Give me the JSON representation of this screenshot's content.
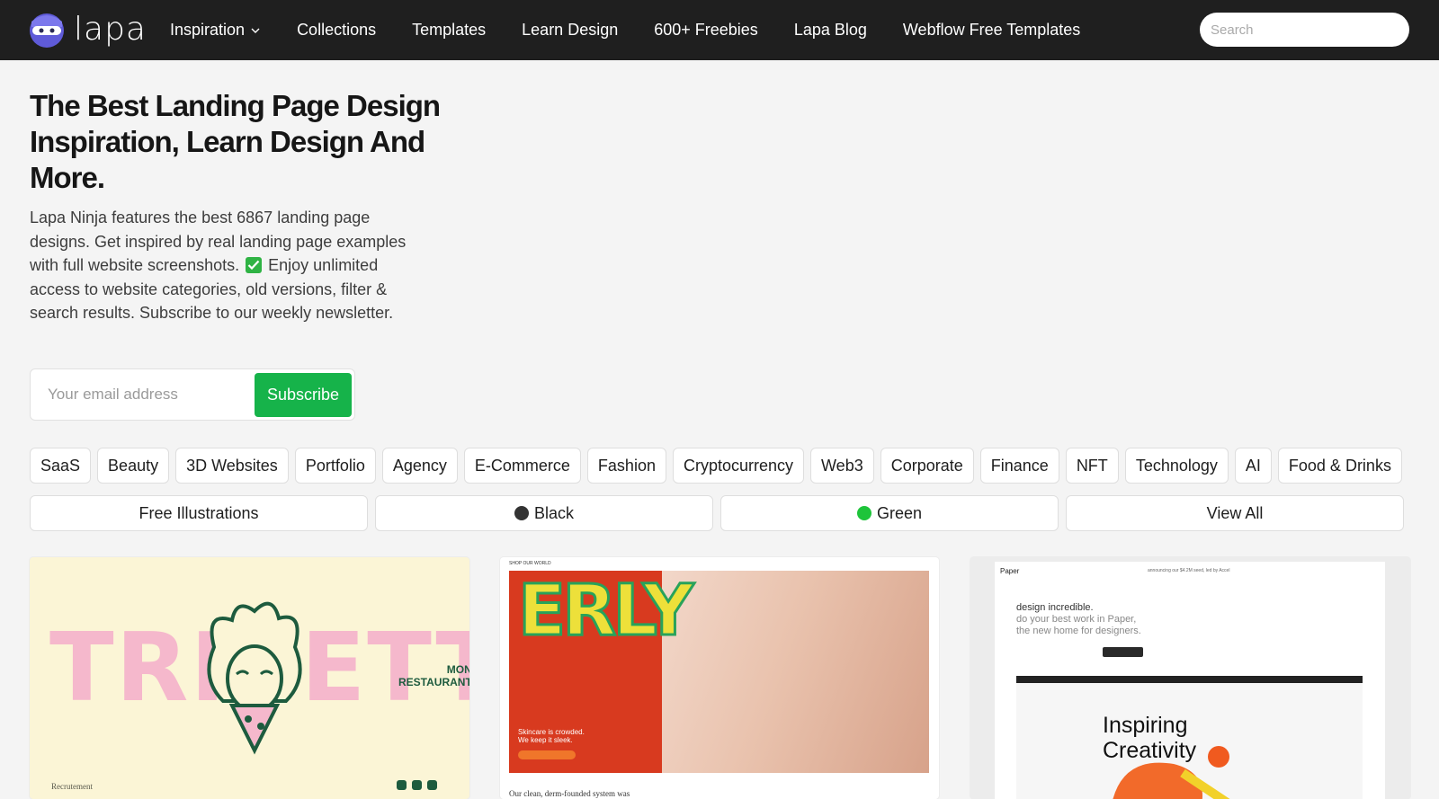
{
  "nav": {
    "logo_text": "lapa",
    "links": [
      "Inspiration",
      "Collections",
      "Templates",
      "Learn Design",
      "600+ Freebies",
      "Lapa Blog",
      "Webflow Free Templates"
    ],
    "search_placeholder": "Search"
  },
  "hero": {
    "title": "The Best Landing Page Design Inspiration, Learn Design And More.",
    "desc_before": "Lapa Ninja features the best 6867 landing page designs. Get inspired by real landing page examples with full website screenshots.",
    "desc_after": "Enjoy unlimited access to website categories, old versions, filter & search results. Subscribe to our weekly newsletter."
  },
  "newsletter": {
    "email_placeholder": "Your email address",
    "subscribe_label": "Subscribe"
  },
  "tags": [
    "SaaS",
    "Beauty",
    "3D Websites",
    "Portfolio",
    "Agency",
    "E-Commerce",
    "Fashion",
    "Cryptocurrency",
    "Web3",
    "Corporate",
    "Finance",
    "NFT",
    "Technology",
    "AI",
    "Food & Drinks"
  ],
  "filters": {
    "illustrations": "Free Illustrations",
    "black": "Black",
    "green": "Green",
    "view_all": "View All"
  },
  "cards": {
    "c1": {
      "headline": "TRIBETTA",
      "brand_line1": "MON",
      "brand_line2": "RESTAURANT",
      "footer": "Recrutement"
    },
    "c2": {
      "headline": "ERLY",
      "top": "SHOP   OUR WORLD",
      "caption_line1": "Skincare is crowded.",
      "caption_line2": "We keep it sleek.",
      "bottom": "Our clean, derm-founded system was"
    },
    "c3": {
      "logo": "Paper",
      "announce": "announcing our $4.2M seed, led by Accel",
      "h1": "design incredible.",
      "h2": "do your best work in Paper,",
      "h3": "the new home for designers.",
      "insp1": "Inspiring",
      "insp2": "Creativity"
    }
  },
  "colors": {
    "nav_bg": "#1f1f1f",
    "accent_green": "#16b34a",
    "black_dot": "#333333",
    "green_dot": "#1ec43a"
  }
}
